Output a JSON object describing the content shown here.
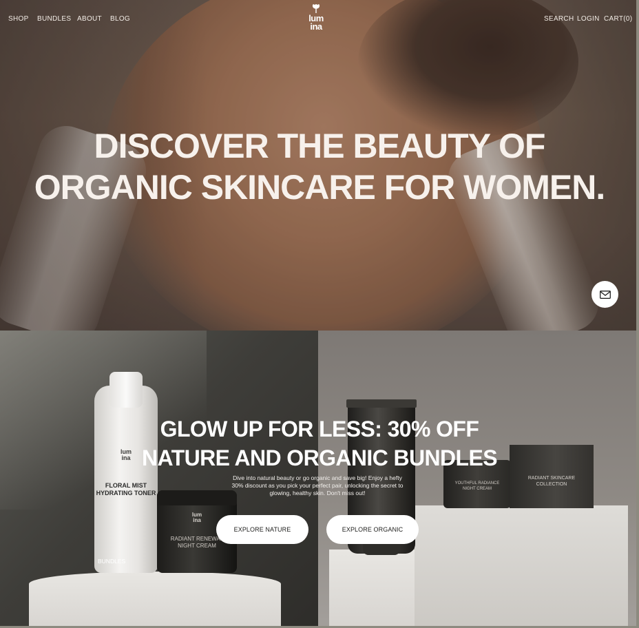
{
  "nav": {
    "left": [
      "SHOP",
      "BUNDLES",
      "ABOUT",
      "BLOG"
    ],
    "right": [
      "SEARCH",
      "LOGIN",
      "CART(0)"
    ],
    "logo_line1": "lum",
    "logo_line2": "ina",
    "logo_icon": "leaf-sprout-icon"
  },
  "hero": {
    "title_line1": "DISCOVER THE BEAUTY OF",
    "title_line2": "ORGANIC SKINCARE FOR WOMEN.",
    "contact_icon": "envelope-icon"
  },
  "promo": {
    "title_line1": "GLOW UP FOR LESS: 30% OFF",
    "title_line2": "NATURE AND ORGANIC BUNDLES",
    "body_line1": "Dive into natural beauty or go organic and save big! Enjoy a hefty",
    "body_line2": "30% discount as you pick your perfect pair, unlocking the secret to",
    "body_line3": "glowing, healthy skin. Don't miss out!",
    "button_nature": "EXPLORE NATURE",
    "button_organic": "EXPLORE ORGANIC",
    "tag": "BUNDLES"
  },
  "products": {
    "bottle_line1": "FLORAL MIST",
    "bottle_line2": "HYDRATING TONER",
    "jar_line1": "RADIANT RENEWAL",
    "jar_line2": "NIGHT CREAM",
    "jar2_line1": "YOUTHFUL RADIANCE",
    "jar2_line2": "NIGHT CREAM",
    "box_line1": "RADIANT SKINCARE",
    "box_line2": "COLLECTION"
  }
}
